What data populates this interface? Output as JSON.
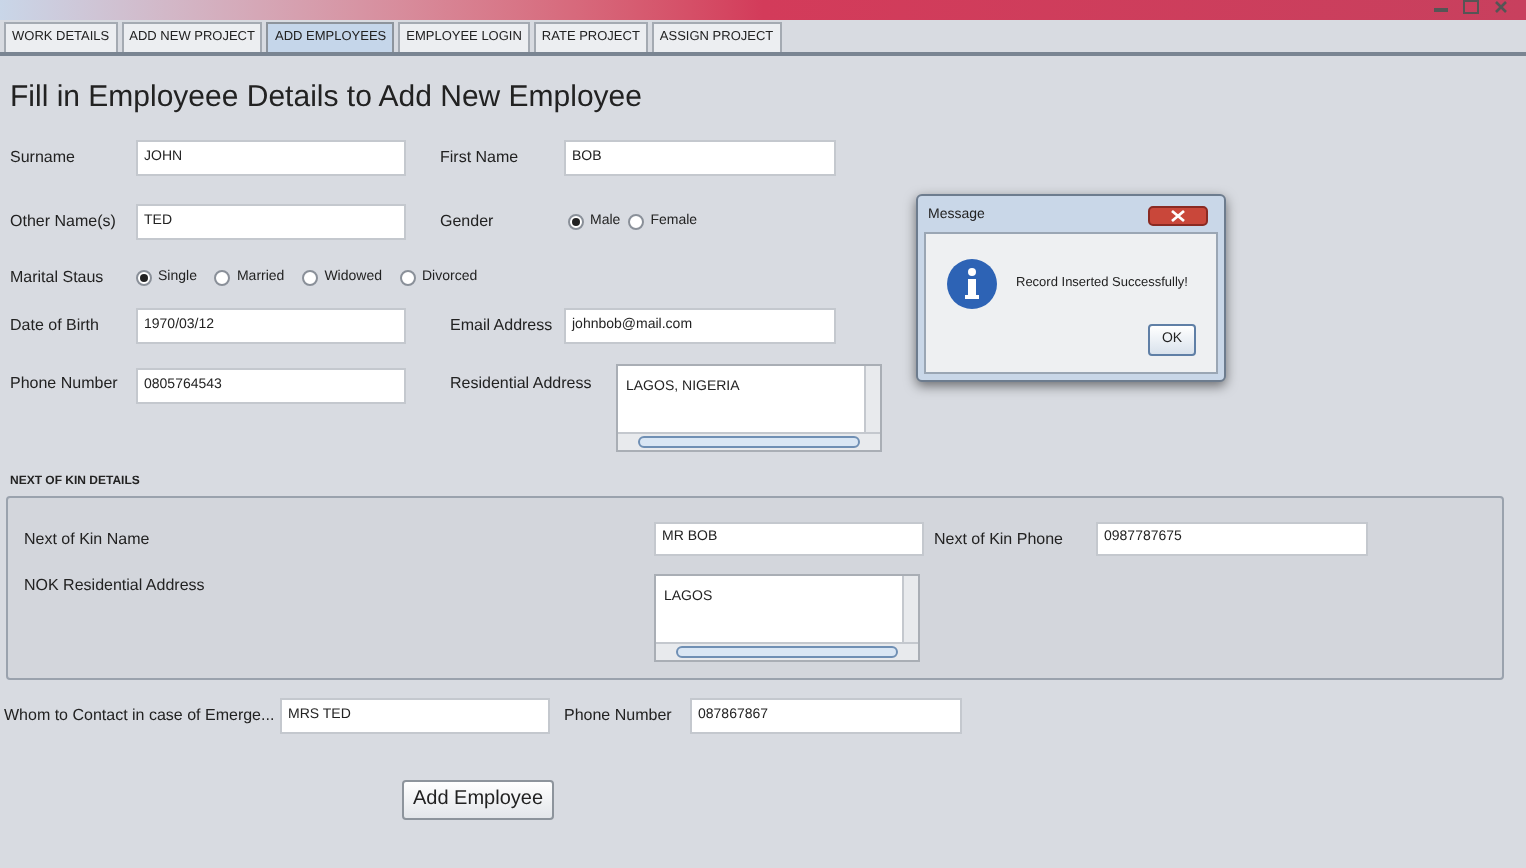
{
  "tabs": [
    {
      "label": "WORK DETAILS",
      "selected": false
    },
    {
      "label": "ADD NEW PROJECT",
      "selected": false
    },
    {
      "label": "ADD EMPLOYEES",
      "selected": true
    },
    {
      "label": "EMPLOYEE LOGIN",
      "selected": false
    },
    {
      "label": "RATE PROJECT",
      "selected": false
    },
    {
      "label": "ASSIGN PROJECT",
      "selected": false
    }
  ],
  "heading": "Fill in Employeee Details to Add New Employee",
  "surname": {
    "label": "Surname",
    "value": "JOHN"
  },
  "first_name": {
    "label": "First Name",
    "value": "BOB"
  },
  "other_names": {
    "label": "Other Name(s)",
    "value": "TED"
  },
  "gender": {
    "label": "Gender",
    "options": [
      {
        "label": "Male",
        "selected": true
      },
      {
        "label": "Female",
        "selected": false
      }
    ]
  },
  "marital_status": {
    "label": "Marital Staus",
    "options": [
      {
        "label": "Single",
        "selected": true
      },
      {
        "label": "Married",
        "selected": false
      },
      {
        "label": "Widowed",
        "selected": false
      },
      {
        "label": "Divorced",
        "selected": false
      }
    ]
  },
  "date_of_birth": {
    "label": "Date of Birth",
    "value": "1970/03/12"
  },
  "email": {
    "label": "Email Address",
    "value": "johnbob@mail.com"
  },
  "phone": {
    "label": "Phone Number",
    "value": "0805764543"
  },
  "residential_address": {
    "label": "Residential Address",
    "value": "LAGOS, NIGERIA"
  },
  "next_of_kin": {
    "title": "NEXT OF KIN DETAILS",
    "name": {
      "label": "Next of Kin Name",
      "value": "MR BOB"
    },
    "phone": {
      "label": "Next of Kin Phone",
      "value": "0987787675"
    },
    "address": {
      "label": "NOK Residential Address",
      "value": "LAGOS"
    }
  },
  "emergency_contact": {
    "label": "Whom to Contact in case of Emerge...",
    "value": "MRS TED"
  },
  "emergency_phone": {
    "label": "Phone Number",
    "value": "087867867"
  },
  "add_button": "Add Employee",
  "dialog": {
    "title": "Message",
    "message": "Record Inserted Successfully!",
    "button": "OK"
  }
}
